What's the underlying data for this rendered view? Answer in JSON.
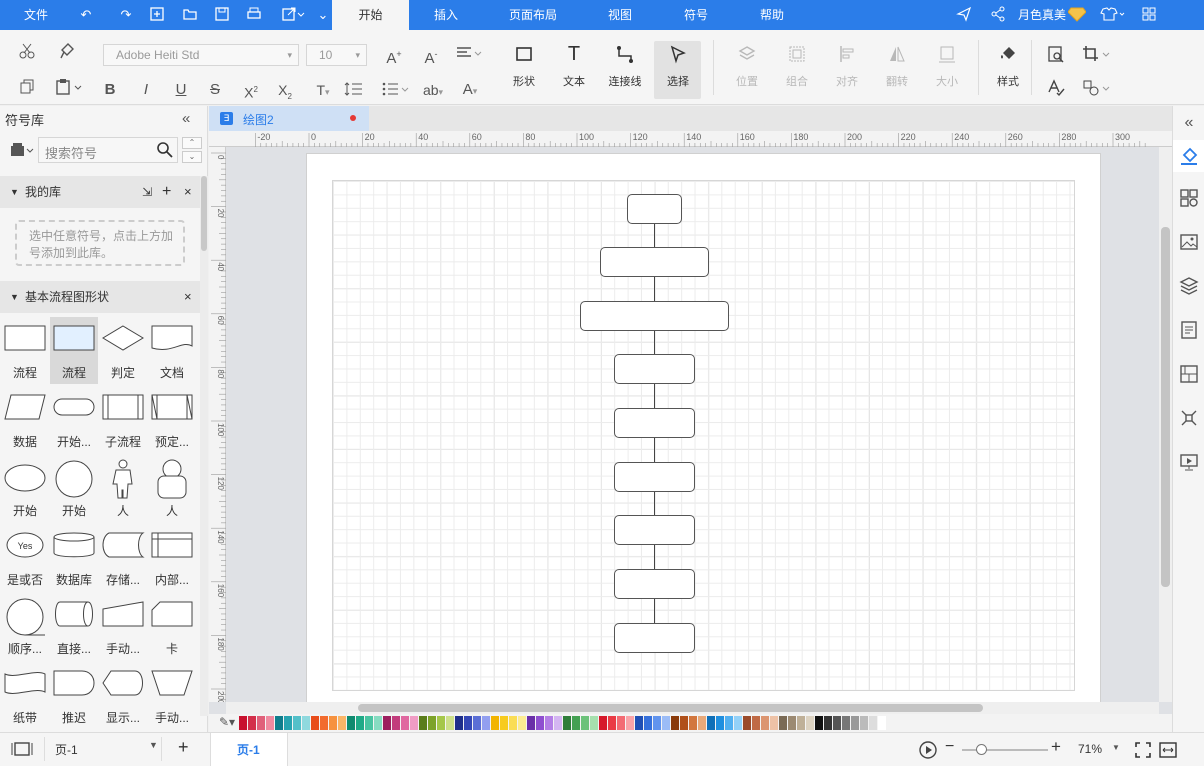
{
  "menu": {
    "file": "文件",
    "tabs": [
      "开始",
      "插入",
      "页面布局",
      "视图",
      "符号",
      "帮助"
    ],
    "active_tab": "开始",
    "user": "月色真美"
  },
  "ribbon": {
    "font_name": "Adobe Heiti Std",
    "font_size": "10",
    "tools": {
      "shape": "形状",
      "text": "文本",
      "connector": "连接线",
      "select": "选择",
      "position": "位置",
      "group": "组合",
      "align": "对齐",
      "flip": "翻转",
      "size": "大小",
      "style": "样式"
    }
  },
  "library": {
    "title": "符号库",
    "search_placeholder": "搜索符号",
    "my_library": "我的库",
    "my_library_hint": "选中任意符号，点击上方加号添加到此库。",
    "basic_flowchart": "基本流程图形状",
    "shapes": [
      "流程",
      "流程",
      "判定",
      "文档",
      "数据",
      "开始...",
      "子流程",
      "预定...",
      "开始",
      "开始",
      "人",
      "人",
      "是或否",
      "数据库",
      "存储...",
      "内部...",
      "顺序...",
      "直接...",
      "手动...",
      "卡",
      "纸带",
      "推迟",
      "显示...",
      "手动..."
    ],
    "yes_label": "Yes"
  },
  "document": {
    "tab_name": "绘图2"
  },
  "ruler": {
    "top": [
      "-20",
      "0",
      "20",
      "40",
      "60",
      "80",
      "100",
      "120",
      "140",
      "160",
      "180",
      "200",
      "220",
      "240",
      "260",
      "280",
      "300"
    ],
    "left": [
      "0",
      "20",
      "40",
      "60",
      "80",
      "100",
      "120",
      "140",
      "160",
      "180",
      "200"
    ]
  },
  "palette": [
    "#c8102e",
    "#d32f4a",
    "#e0607a",
    "#f08aa0",
    "#0f7d8c",
    "#27a3b0",
    "#53c0c9",
    "#8fd9de",
    "#e84c1a",
    "#f26b2d",
    "#f6923f",
    "#fab567",
    "#0f8a6f",
    "#1faa87",
    "#49c4a1",
    "#86dcc1",
    "#9c1f5e",
    "#c23c7c",
    "#e068a0",
    "#f09cc4",
    "#5a7d1a",
    "#7da329",
    "#a5c74a",
    "#cde08a",
    "#1f2f8a",
    "#3447b5",
    "#5b6fd6",
    "#929ff0",
    "#f2b400",
    "#f7cb1e",
    "#fadd55",
    "#fcec92",
    "#6a2fa8",
    "#8f4fd0",
    "#b47fe6",
    "#d4b5f2",
    "#2f7d3a",
    "#44a052",
    "#6cc27a",
    "#a6e0ae",
    "#d6182a",
    "#ea3b45",
    "#f36b73",
    "#f9a3a8",
    "#1f4fb4",
    "#3570db",
    "#6194ee",
    "#9bbcf7",
    "#8a3a0a",
    "#b0501a",
    "#d2773e",
    "#e8a97a",
    "#0e6fb8",
    "#1f8fdf",
    "#52b0f0",
    "#93d1f8",
    "#9a4a2a",
    "#c06a45",
    "#dc9570",
    "#eec2a6",
    "#7a6a55",
    "#9c8a72",
    "#bfb098",
    "#ddd3c2",
    "#111111",
    "#333333",
    "#555555",
    "#777777",
    "#999999",
    "#bbbbbb",
    "#dddddd",
    "#ffffff"
  ],
  "status": {
    "page_selector": "页-1",
    "current_page": "页-1",
    "zoom": "71%"
  }
}
